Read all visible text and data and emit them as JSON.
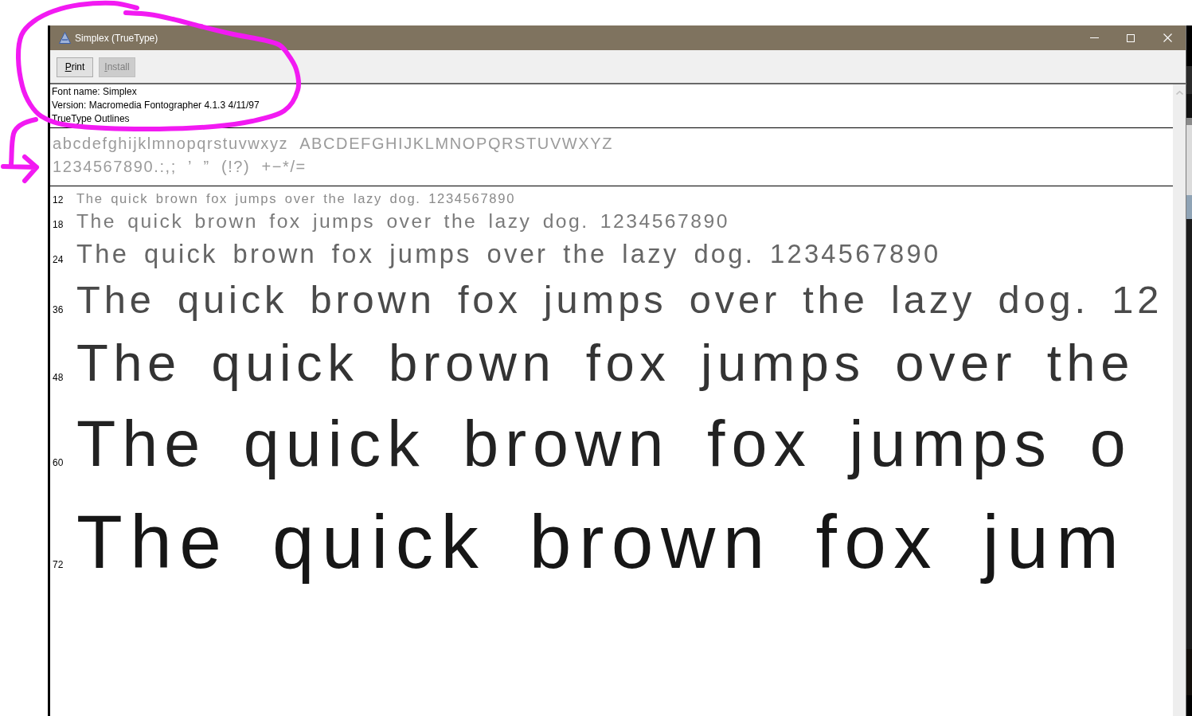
{
  "hand_drawn_marks": {
    "loop": true,
    "arrow": true
  },
  "window": {
    "title": "Simplex (TrueType)"
  },
  "toolbar": [
    {
      "label": "Print",
      "disabled": false
    },
    {
      "label": "Install",
      "disabled": true
    }
  ],
  "font_info": [
    "Font name: Simplex",
    "Version: Macromedia Fontographer 4.1.3 4/11/97",
    "TrueType Outlines"
  ],
  "character_set": [
    [
      "abcdefghijklmnopqrstuvwxyz",
      "ABCDEFGHIJKLMNOPQRSTUVWXYZ"
    ],
    [
      "1234567890.:,; ’ ” (!?) +−*/="
    ]
  ],
  "size_samples": [
    {
      "size": "12",
      "text": "The quick brown fox jumps over the lazy dog. 1234567890"
    },
    {
      "size": "18",
      "text": "The quick brown fox jumps over the lazy dog. 1234567890"
    },
    {
      "size": "24",
      "text": "The quick brown fox jumps over the lazy dog. 1234567890"
    },
    {
      "size": "36",
      "text": "The quick brown fox jumps over the lazy dog. 12"
    },
    {
      "size": "48",
      "text": "The quick brown fox jumps over the"
    },
    {
      "size": "60",
      "text": "The quick brown fox jumps o"
    },
    {
      "size": "72",
      "text": "The quick brown fox jum"
    }
  ]
}
